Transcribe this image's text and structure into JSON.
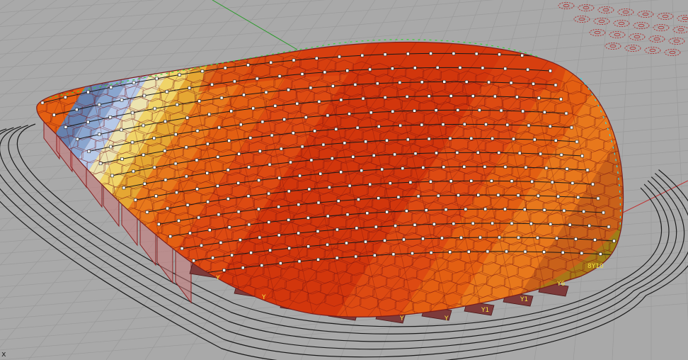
{
  "viewport": {
    "name": "Perspective 3D viewport",
    "axis_corner_label": "x",
    "background": "#a9a9a9",
    "grid_color": "#9a9a9a",
    "grid_major_color": "#8f8f8f"
  },
  "model": {
    "type": "hexagonal-paneled shell roof with analysis color map",
    "colors": {
      "deep_red": "#d2360c",
      "red": "#dd4a12",
      "orange_red": "#e35f12",
      "orange": "#e8781c",
      "dark_orange": "#c9611a",
      "olive": "#9c7f18",
      "gold": "#e5a733",
      "yellow": "#f0d468",
      "pale_yellow": "#ece3b0",
      "light_blue": "#b6c9e8",
      "mid_blue": "#8aa6cf",
      "steel_blue": "#6781ad",
      "mesh_line": "#7a1d1d",
      "rib_line": "#1a1a1a",
      "footing": "#7d3a3a",
      "control_point": "#ffffff",
      "green_edge": "#3ad13a",
      "cyan_edge": "#2dd8e8"
    },
    "annotations": [
      "Y",
      "Y1",
      "Y6",
      "Y8",
      "8Y10"
    ]
  },
  "contours": {
    "count": 6,
    "color": "#1b1b1b"
  }
}
